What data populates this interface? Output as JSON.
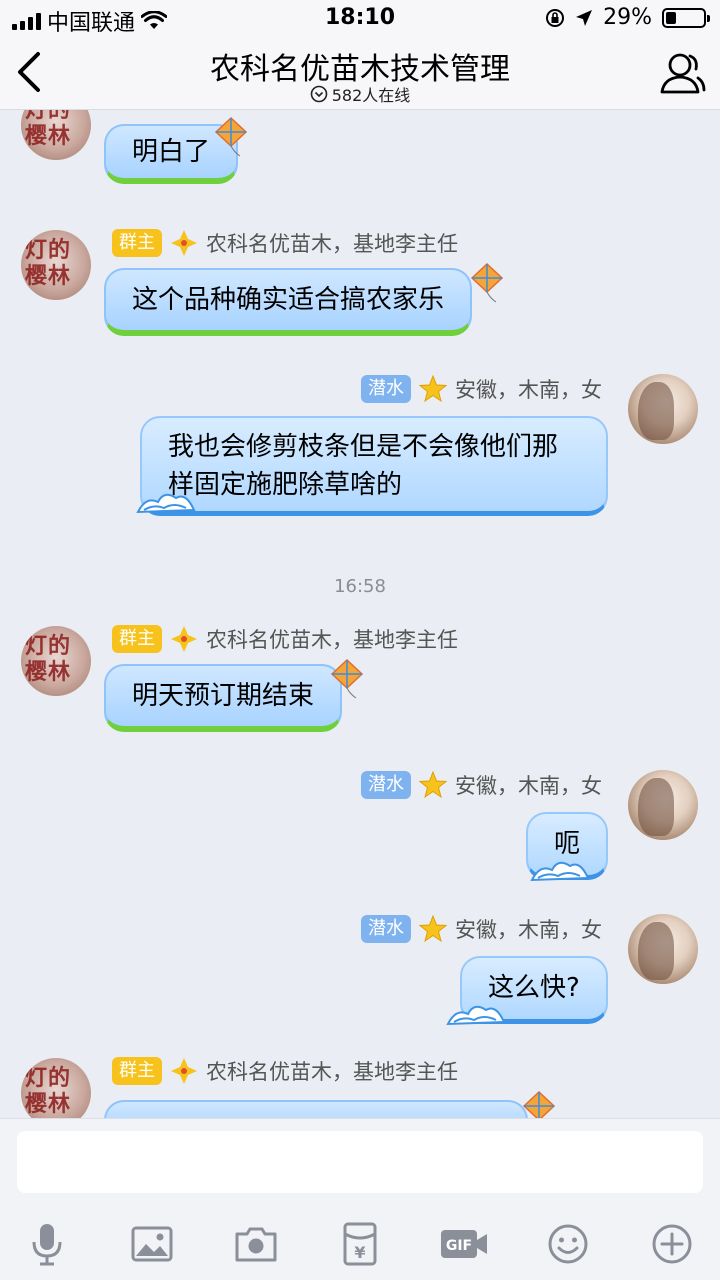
{
  "status_bar": {
    "carrier": "中国联通",
    "time": "18:10",
    "battery": "29%",
    "battery_level": 0.29
  },
  "header": {
    "title": "农科名优苗木技术管理",
    "online": "582人在线"
  },
  "messages": [
    {
      "role": "群主",
      "sender": "农科名优苗木，基地李主任",
      "text": "明白了"
    },
    {
      "role": "群主",
      "sender": "农科名优苗木，基地李主任",
      "text": "这个品种确实适合搞农家乐"
    },
    {
      "role": "潜水",
      "sender": "安徽，木南，女",
      "text_line1": "我也会修剪枝条但是不会像他们那",
      "text_line2": "样固定施肥除草啥的"
    },
    {
      "timestamp": "16:58"
    },
    {
      "role": "群主",
      "sender": "农科名优苗木，基地李主任",
      "text": "明天预订期结束"
    },
    {
      "role": "潜水",
      "sender": "安徽，木南，女",
      "text": "呃"
    },
    {
      "role": "潜水",
      "sender": "安徽，木南，女",
      "text": "这么快?"
    },
    {
      "role": "群主",
      "sender": "农科名优苗木，基地李主任",
      "text": ""
    }
  ],
  "input": {
    "value": "",
    "placeholder": ""
  },
  "toolbar_icons": [
    "microphone-icon",
    "image-icon",
    "camera-icon",
    "red-packet-icon",
    "gif-icon",
    "emoji-icon",
    "plus-icon"
  ],
  "colors": {
    "owner_badge": "#f6c21b",
    "lurk_badge": "#7fb3f0",
    "bubble_blue": "#a8d3ff",
    "grass_green": "#6fcf3d"
  }
}
